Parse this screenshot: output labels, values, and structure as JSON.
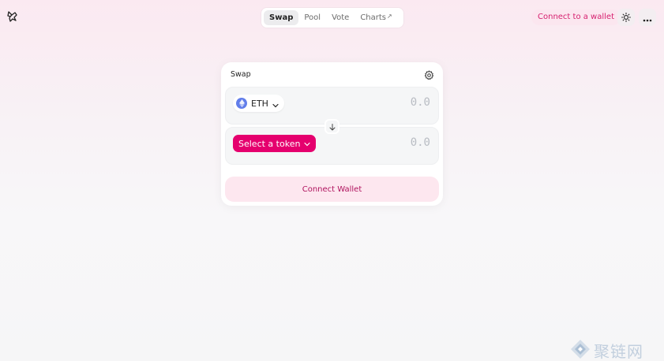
{
  "header": {
    "logo_icon": "unicorn-logo-icon",
    "nav": [
      {
        "label": "Swap",
        "active": true
      },
      {
        "label": "Pool",
        "active": false
      },
      {
        "label": "Vote",
        "active": false
      },
      {
        "label": "Charts",
        "active": false,
        "external_marker": "↗"
      }
    ],
    "connect_label": "Connect to a wallet",
    "theme_icon": "sun-icon",
    "more_icon": "more-dots-icon"
  },
  "swap": {
    "title": "Swap",
    "settings_icon": "gear-icon",
    "input": {
      "token": "ETH",
      "amount": "0.0"
    },
    "output": {
      "select_label": "Select a token",
      "amount": "0.0"
    },
    "switch_icon": "arrow-down-icon",
    "connect_label": "Connect Wallet"
  },
  "watermark": {
    "text": "聚链网"
  },
  "colors": {
    "accent": "#e5006e",
    "accent_text": "#d6206f",
    "eth": "#627eea"
  }
}
